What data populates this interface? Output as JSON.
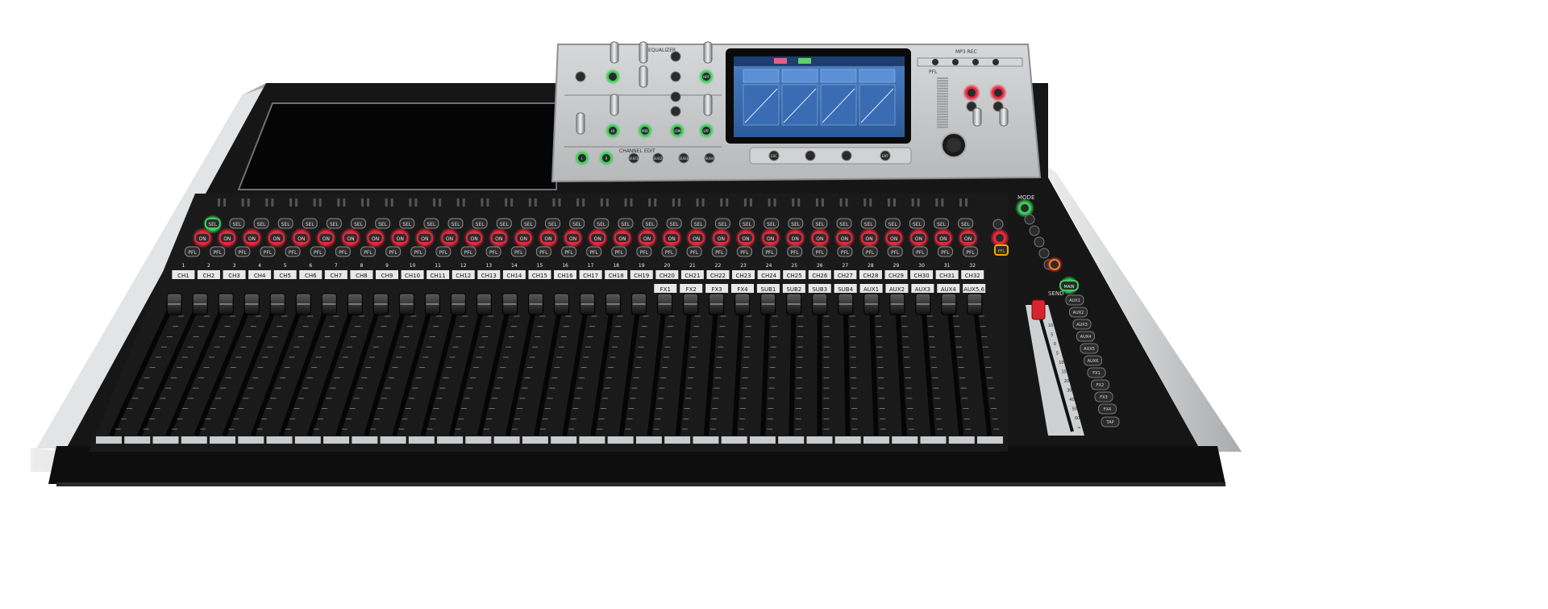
{
  "colors": {
    "chassis": "#1a1a1a",
    "rail": "#d9dadb",
    "panel": "#c4c6c8",
    "screen": "#3b6fb0",
    "led_on": "#e8283c",
    "led_sel": "#3ccf5a",
    "led_pfl": "#f2a800"
  },
  "panel_labels": {
    "equalizer": "EQUALIZER",
    "channel_edit": "CHANNEL EDIT",
    "mode": "MODE",
    "main": "MAIN",
    "send": "SEND",
    "tap": "TAP",
    "pfl": "PFL",
    "top_right": "MP3 REC"
  },
  "eq_buttons": [
    "HPF",
    "HI",
    "MID",
    "LOW",
    "LPF"
  ],
  "edit_buttons": [
    "L",
    "R",
    "SUB1",
    "SUB2",
    "SUB3",
    "SUB4"
  ],
  "screen_softkeys": [
    "ESC",
    "",
    "",
    "ENT"
  ],
  "screen_tabs": [
    "",
    "",
    "",
    ""
  ],
  "strip_button_labels": {
    "sel": "SEL",
    "on": "ON",
    "pfl": "PFL"
  },
  "channels": [
    {
      "num": "1",
      "name": "CH1"
    },
    {
      "num": "2",
      "name": "CH2"
    },
    {
      "num": "3",
      "name": "CH3"
    },
    {
      "num": "4",
      "name": "CH4"
    },
    {
      "num": "5",
      "name": "CH5"
    },
    {
      "num": "6",
      "name": "CH6"
    },
    {
      "num": "7",
      "name": "CH7"
    },
    {
      "num": "8",
      "name": "CH8"
    },
    {
      "num": "9",
      "name": "CH9"
    },
    {
      "num": "10",
      "name": "CH10"
    },
    {
      "num": "11",
      "name": "CH11"
    },
    {
      "num": "12",
      "name": "CH12"
    },
    {
      "num": "13",
      "name": "CH13"
    },
    {
      "num": "14",
      "name": "CH14"
    },
    {
      "num": "15",
      "name": "CH15"
    },
    {
      "num": "16",
      "name": "CH16"
    },
    {
      "num": "17",
      "name": "CH17"
    },
    {
      "num": "18",
      "name": "CH18"
    },
    {
      "num": "19",
      "name": "CH19"
    },
    {
      "num": "20",
      "name": "CH20"
    },
    {
      "num": "21",
      "name": "CH21"
    },
    {
      "num": "22",
      "name": "CH22"
    },
    {
      "num": "23",
      "name": "CH23"
    },
    {
      "num": "24",
      "name": "CH24"
    },
    {
      "num": "25",
      "name": "CH25"
    },
    {
      "num": "26",
      "name": "CH26"
    },
    {
      "num": "27",
      "name": "CH27"
    },
    {
      "num": "28",
      "name": "CH28"
    },
    {
      "num": "29",
      "name": "CH29"
    },
    {
      "num": "30",
      "name": "CH30"
    },
    {
      "num": "31",
      "name": "CH31"
    },
    {
      "num": "32",
      "name": "CH32"
    }
  ],
  "layer2_names": [
    "FX1",
    "FX2",
    "FX3",
    "FX4",
    "SUB1",
    "SUB2",
    "SUB3",
    "SUB4",
    "AUX1",
    "AUX2",
    "AUX3",
    "AUX4",
    "AUX5,6"
  ],
  "send_buttons": [
    "AUX1",
    "AUX2",
    "AUX3",
    "AUX4",
    "AUX5",
    "AUX6",
    "FX1",
    "FX2",
    "FX3",
    "FX4"
  ],
  "fader_scale": [
    "10",
    "5",
    "0",
    "5",
    "10",
    "15",
    "20",
    "30",
    "40",
    "50",
    "60",
    "∞"
  ]
}
